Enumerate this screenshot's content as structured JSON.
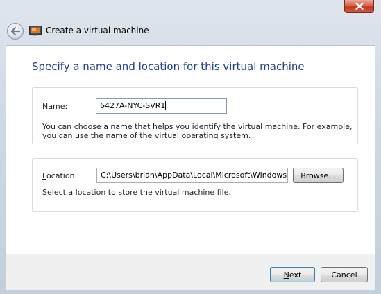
{
  "window": {
    "title": "Create a virtual machine",
    "close_icon": "close-icon",
    "back_icon": "back-arrow-icon",
    "app_icon": "virtual-machine-icon"
  },
  "page": {
    "heading": "Specify a name and location for this virtual machine"
  },
  "name_group": {
    "label_before": "Na",
    "label_accel": "m",
    "label_after": "e:",
    "value": "6427A-NYC-SVR1",
    "hint_line1": "You can choose a name that helps you identify the virtual machine. For example,",
    "hint_line2": "you can use the name of the virtual operating system."
  },
  "location_group": {
    "label_accel": "L",
    "label_after": "ocation:",
    "value": "C:\\Users\\brian\\AppData\\Local\\Microsoft\\Windows V",
    "browse_label": "Browse...",
    "hint": "Select a location to store the virtual machine file."
  },
  "footer": {
    "next_accel": "N",
    "next_rest": "ext",
    "cancel_label": "Cancel"
  },
  "colors": {
    "heading": "#1f3f8f",
    "close_button": "#c0391f",
    "focus_border": "#7a9cc2"
  }
}
